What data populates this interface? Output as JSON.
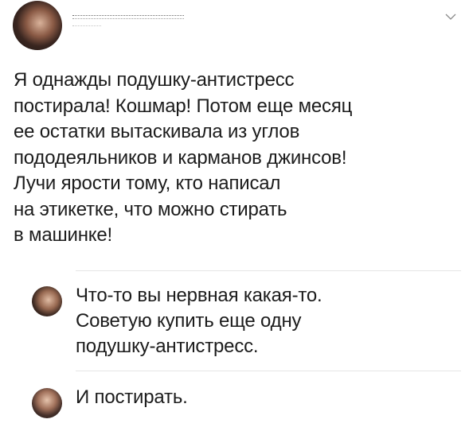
{
  "post": {
    "text": "Я однажды подушку-антистресс\nпостирала! Кошмар! Потом еще месяц\nее остатки вытаскивала из углов\nпододеяльников и карманов джинсов!\nЛучи ярости тому, кто написал\nна этикетке, что можно стирать\nв машинке!"
  },
  "comments": [
    {
      "text": "Что-то вы нервная какая-то.\nСоветую купить еще одну\nподушку-антистресс."
    },
    {
      "text": "И постирать."
    }
  ],
  "icons": {
    "menu": "chevron-down-icon"
  },
  "colors": {
    "text": "#1c1c1c",
    "divider": "#e6e6e6",
    "chevron": "#8a8a8a"
  }
}
